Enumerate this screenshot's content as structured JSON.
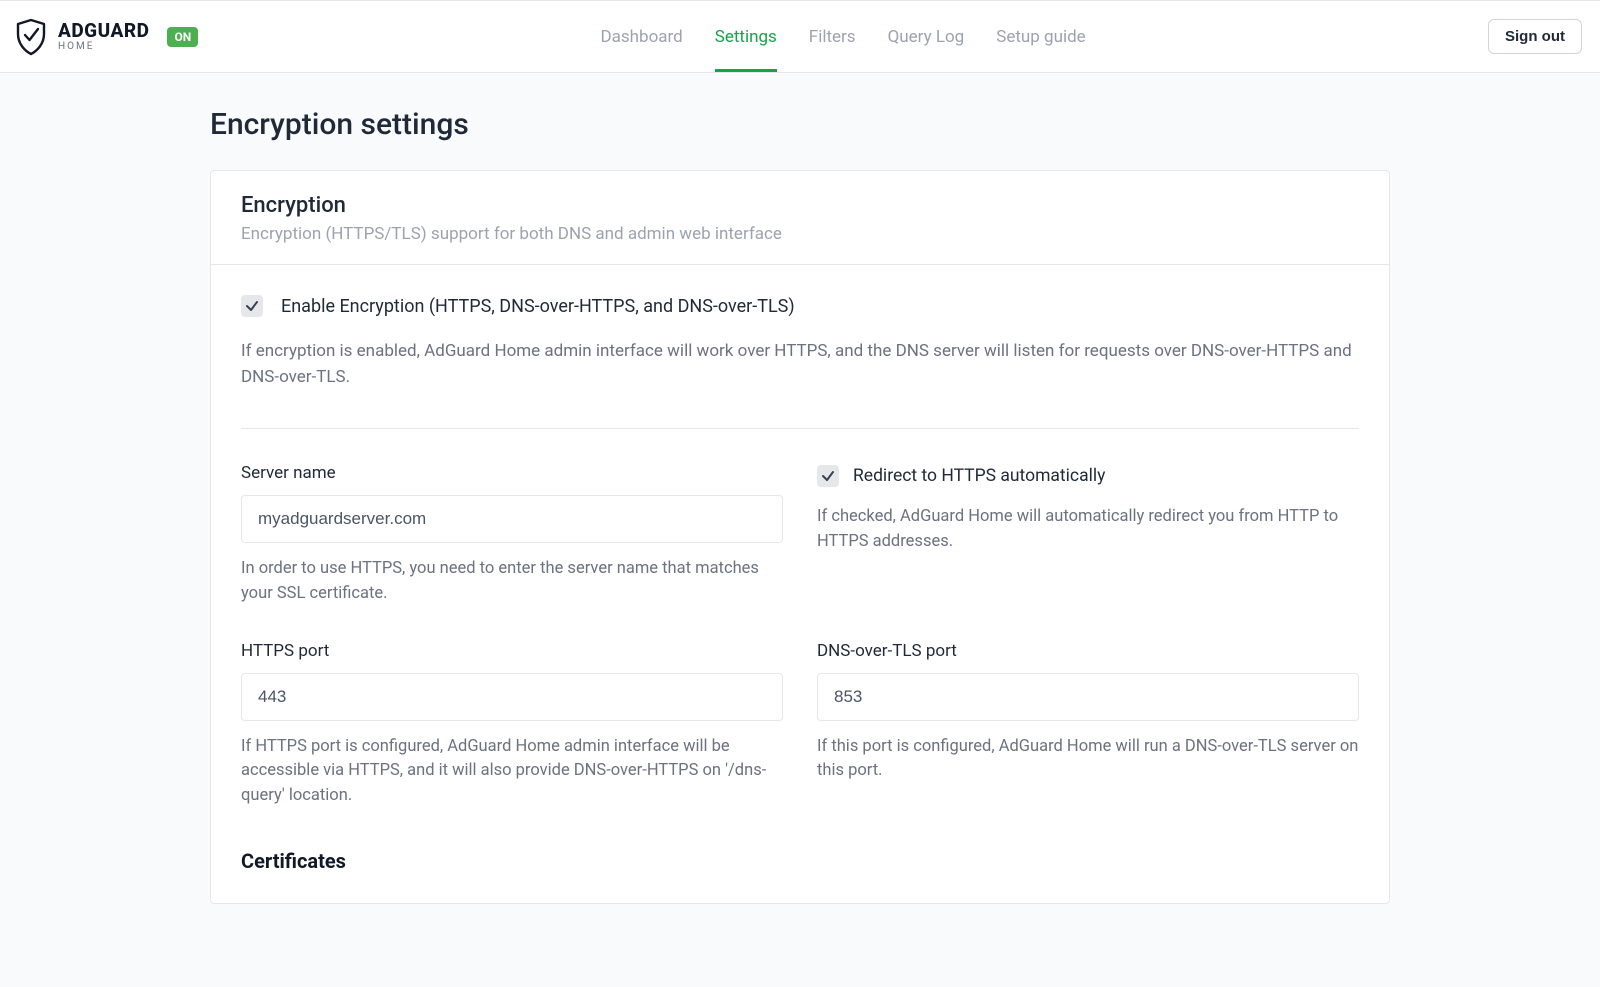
{
  "brand": {
    "name_main": "ADGUARD",
    "name_sub": "HOME",
    "status_label": "ON"
  },
  "nav": {
    "items": [
      {
        "label": "Dashboard",
        "active": false
      },
      {
        "label": "Settings",
        "active": true
      },
      {
        "label": "Filters",
        "active": false
      },
      {
        "label": "Query Log",
        "active": false
      },
      {
        "label": "Setup guide",
        "active": false
      }
    ],
    "signout_label": "Sign out"
  },
  "page": {
    "title": "Encryption settings"
  },
  "panel": {
    "title": "Encryption",
    "subtitle": "Encryption (HTTPS/TLS) support for both DNS and admin web interface"
  },
  "enable": {
    "label": "Enable Encryption (HTTPS, DNS-over-HTTPS, and DNS-over-TLS)",
    "checked": true,
    "help": "If encryption is enabled, AdGuard Home admin interface will work over HTTPS, and the DNS server will listen for requests over DNS-over-HTTPS and DNS-over-TLS."
  },
  "fields": {
    "server_name": {
      "label": "Server name",
      "value": "myadguardserver.com",
      "hint": "In order to use HTTPS, you need to enter the server name that matches your SSL certificate."
    },
    "redirect_https": {
      "label": "Redirect to HTTPS automatically",
      "checked": true,
      "hint": "If checked, AdGuard Home will automatically redirect you from HTTP to HTTPS addresses."
    },
    "https_port": {
      "label": "HTTPS port",
      "value": "443",
      "hint": "If HTTPS port is configured, AdGuard Home admin interface will be accessible via HTTPS, and it will also provide DNS-over-HTTPS on '/dns-query' location."
    },
    "dot_port": {
      "label": "DNS-over-TLS port",
      "value": "853",
      "hint": "If this port is configured, AdGuard Home will run a DNS-over-TLS server on this port."
    }
  },
  "certificates": {
    "title": "Certificates"
  },
  "colors": {
    "accent": "#16a34a",
    "status_badge_bg": "#4caf50"
  }
}
